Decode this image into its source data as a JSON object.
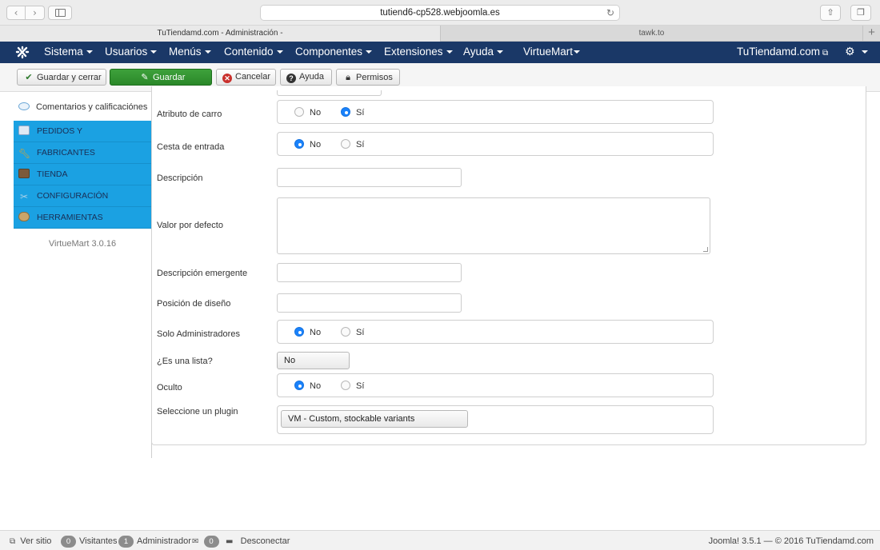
{
  "browser": {
    "url": "tutiend6-cp528.webjoomla.es",
    "tabs": [
      {
        "label": "TuTiendamd.com - Administración -"
      },
      {
        "label": "tawk.to"
      }
    ]
  },
  "menu": {
    "items": [
      {
        "label": "Sistema"
      },
      {
        "label": "Usuarios"
      },
      {
        "label": "Menús"
      },
      {
        "label": "Contenido"
      },
      {
        "label": "Componentes"
      },
      {
        "label": "Extensiones"
      },
      {
        "label": "Ayuda"
      },
      {
        "label": "VirtueMart"
      }
    ],
    "site_link": "TuTiendamd.com"
  },
  "toolbar": {
    "save_close": "Guardar y cerrar",
    "save": "Guardar",
    "cancel": "Cancelar",
    "help": "Ayuda",
    "permissions": "Permisos"
  },
  "sidebar": {
    "top_item": "Comentarios y calificaciónes",
    "items": [
      {
        "label": "PEDIDOS Y",
        "icon": "orders-icon"
      },
      {
        "label": "FABRICANTES",
        "icon": "wrench-icon"
      },
      {
        "label": "TIENDA",
        "icon": "store-icon"
      },
      {
        "label": "CONFIGURACIÓN",
        "icon": "config-icon"
      },
      {
        "label": "HERRAMIENTAS",
        "icon": "tools-icon"
      }
    ],
    "version": "VirtueMart 3.0.16"
  },
  "form": {
    "cart_attribute": {
      "label": "Atributo de carro",
      "no": "No",
      "yes": "Sí",
      "selected": "yes"
    },
    "input_cart": {
      "label": "Cesta de entrada",
      "no": "No",
      "yes": "Sí",
      "selected": "no"
    },
    "description": {
      "label": "Descripción",
      "value": ""
    },
    "default_value": {
      "label": "Valor por defecto",
      "value": ""
    },
    "tooltip": {
      "label": "Descripción emergente",
      "value": ""
    },
    "layout_position": {
      "label": "Posición de diseño",
      "value": ""
    },
    "admin_only": {
      "label": "Solo Administradores",
      "no": "No",
      "yes": "Sí",
      "selected": "no"
    },
    "is_list": {
      "label": "¿Es una lista?",
      "value": "No"
    },
    "hidden": {
      "label": "Oculto",
      "no": "No",
      "yes": "Sí",
      "selected": "no"
    },
    "plugin": {
      "label": "Seleccione un plugin",
      "value": "VM - Custom, stockable variants"
    }
  },
  "status": {
    "view_site": "Ver sitio",
    "visitors_count": "0",
    "visitors_label": "Visitantes",
    "admin_count": "1",
    "admin_label": "Administrador",
    "messages_count": "0",
    "logout": "Desconectar",
    "footer": "Joomla! 3.5.1  —  © 2016 TuTiendamd.com"
  },
  "colors": {
    "menu_bg": "#1a3867",
    "sidebar_accent": "#1ba1e2",
    "save_green": "#2f8f2e",
    "radio_selected": "#1a82fb"
  }
}
